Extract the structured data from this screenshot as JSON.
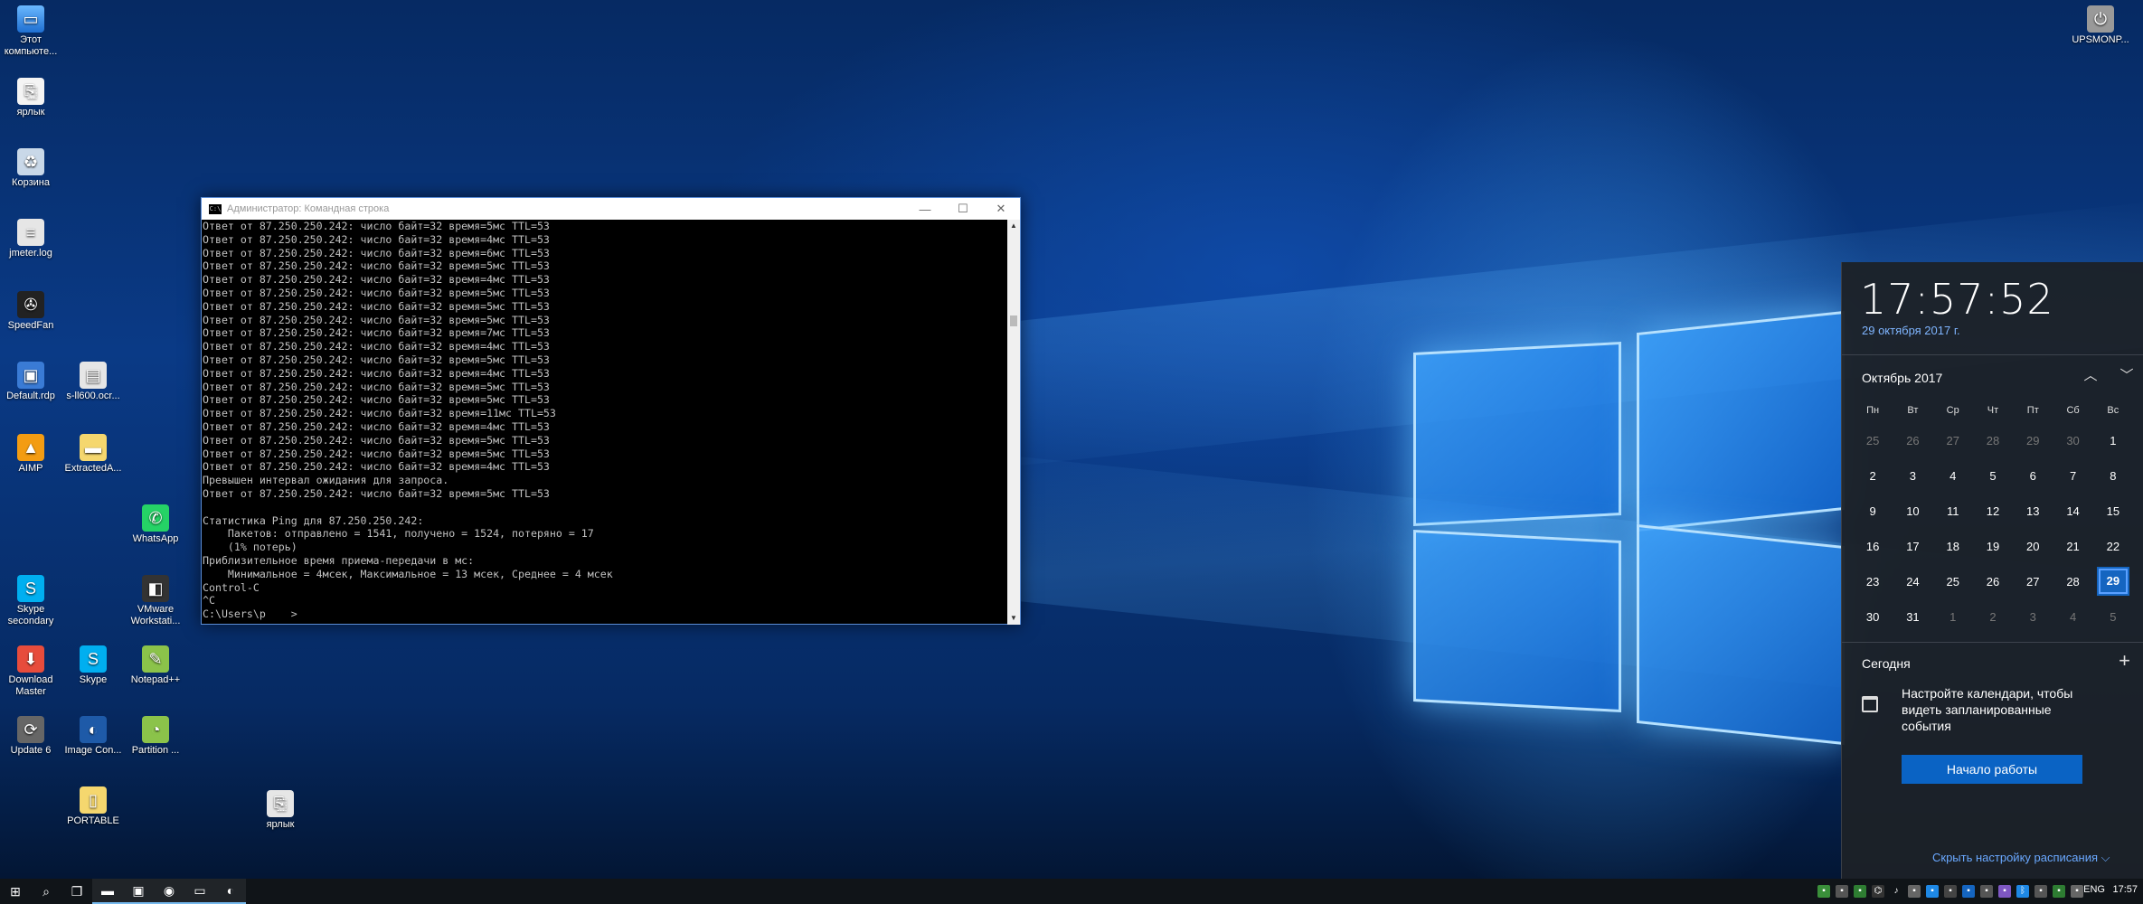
{
  "desktop_icons": [
    {
      "label": "Этот компьюте...",
      "icon": "this-pc-icon"
    },
    {
      "label": "ярлык",
      "icon": "shortcut-file-icon"
    },
    {
      "label": "Корзина",
      "icon": "recycle-bin-icon"
    },
    {
      "label": "jmeter.log",
      "icon": "log-file-icon"
    },
    {
      "label": "SpeedFan",
      "icon": "speedfan-icon"
    },
    {
      "label": "Default.rdp",
      "icon": "rdp-icon"
    },
    {
      "label": "s-ll600.ocr...",
      "icon": "document-icon"
    },
    {
      "label": "AIMP",
      "icon": "aimp-icon"
    },
    {
      "label": "ExtractedA...",
      "icon": "folder-icon"
    },
    {
      "label": "WhatsApp",
      "icon": "whatsapp-icon"
    },
    {
      "label": "Skype secondary",
      "icon": "skype-icon"
    },
    {
      "label": "VMware Workstati...",
      "icon": "vmware-icon"
    },
    {
      "label": "Download Master",
      "icon": "download-master-icon"
    },
    {
      "label": "Skype",
      "icon": "skype-icon"
    },
    {
      "label": "Notepad++",
      "icon": "notepadpp-icon"
    },
    {
      "label": "Update 6",
      "icon": "update-icon"
    },
    {
      "label": "Image Con...",
      "icon": "image-converter-icon"
    },
    {
      "label": "Partition ...",
      "icon": "partition-tool-icon"
    },
    {
      "label": "PORTABLE",
      "icon": "portable-icon"
    },
    {
      "label": "ярлык",
      "icon": "shortcut-icon"
    },
    {
      "label": "UPSMONP...",
      "icon": "ups-monitor-icon"
    }
  ],
  "cmd": {
    "title": "Администратор: Командная строка",
    "lines": [
      "Ответ от 87.250.250.242: число байт=32 время=5мс TTL=53",
      "Ответ от 87.250.250.242: число байт=32 время=4мс TTL=53",
      "Ответ от 87.250.250.242: число байт=32 время=6мс TTL=53",
      "Ответ от 87.250.250.242: число байт=32 время=5мс TTL=53",
      "Ответ от 87.250.250.242: число байт=32 время=4мс TTL=53",
      "Ответ от 87.250.250.242: число байт=32 время=5мс TTL=53",
      "Ответ от 87.250.250.242: число байт=32 время=5мс TTL=53",
      "Ответ от 87.250.250.242: число байт=32 время=5мс TTL=53",
      "Ответ от 87.250.250.242: число байт=32 время=7мс TTL=53",
      "Ответ от 87.250.250.242: число байт=32 время=4мс TTL=53",
      "Ответ от 87.250.250.242: число байт=32 время=5мс TTL=53",
      "Ответ от 87.250.250.242: число байт=32 время=4мс TTL=53",
      "Ответ от 87.250.250.242: число байт=32 время=5мс TTL=53",
      "Ответ от 87.250.250.242: число байт=32 время=5мс TTL=53",
      "Ответ от 87.250.250.242: число байт=32 время=11мс TTL=53",
      "Ответ от 87.250.250.242: число байт=32 время=4мс TTL=53",
      "Ответ от 87.250.250.242: число байт=32 время=5мс TTL=53",
      "Ответ от 87.250.250.242: число байт=32 время=5мс TTL=53",
      "Ответ от 87.250.250.242: число байт=32 время=4мс TTL=53",
      "Превышен интервал ожидания для запроса.",
      "Ответ от 87.250.250.242: число байт=32 время=5мс TTL=53",
      "",
      "Статистика Ping для 87.250.250.242:",
      "    Пакетов: отправлено = 1541, получено = 1524, потеряно = 17",
      "    (1% потерь)",
      "Приблизительное время приема-передачи в мс:",
      "    Минимальное = 4мсек, Максимальное = 13 мсек, Среднее = 4 мсек",
      "Control-C",
      "^C",
      "C:\\Users\\p    >"
    ]
  },
  "calendar": {
    "time": "17:57:52",
    "date": "29 октября 2017 г.",
    "month": "Октябрь 2017",
    "weekdays": [
      "Пн",
      "Вт",
      "Ср",
      "Чт",
      "Пт",
      "Сб",
      "Вс"
    ],
    "days": [
      {
        "d": "25",
        "dim": true
      },
      {
        "d": "26",
        "dim": true
      },
      {
        "d": "27",
        "dim": true
      },
      {
        "d": "28",
        "dim": true
      },
      {
        "d": "29",
        "dim": true
      },
      {
        "d": "30",
        "dim": true
      },
      {
        "d": "1"
      },
      {
        "d": "2"
      },
      {
        "d": "3"
      },
      {
        "d": "4"
      },
      {
        "d": "5"
      },
      {
        "d": "6"
      },
      {
        "d": "7"
      },
      {
        "d": "8"
      },
      {
        "d": "9"
      },
      {
        "d": "10"
      },
      {
        "d": "11"
      },
      {
        "d": "12"
      },
      {
        "d": "13"
      },
      {
        "d": "14"
      },
      {
        "d": "15"
      },
      {
        "d": "16"
      },
      {
        "d": "17"
      },
      {
        "d": "18"
      },
      {
        "d": "19"
      },
      {
        "d": "20"
      },
      {
        "d": "21"
      },
      {
        "d": "22"
      },
      {
        "d": "23"
      },
      {
        "d": "24"
      },
      {
        "d": "25"
      },
      {
        "d": "26"
      },
      {
        "d": "27"
      },
      {
        "d": "28"
      },
      {
        "d": "29",
        "today": true
      },
      {
        "d": "30"
      },
      {
        "d": "31"
      },
      {
        "d": "1",
        "dim": true
      },
      {
        "d": "2",
        "dim": true
      },
      {
        "d": "3",
        "dim": true
      },
      {
        "d": "4",
        "dim": true
      },
      {
        "d": "5",
        "dim": true
      }
    ],
    "today_heading": "Сегодня",
    "setup_text": "Настройте календари, чтобы видеть запланированные события",
    "start_button": "Начало работы",
    "hide_link": "Скрыть настройку расписания"
  },
  "taskbar": {
    "items": [
      "start-icon",
      "search-icon",
      "task-view-icon",
      "file-explorer-icon",
      "app-icon",
      "chrome-icon",
      "cmd-icon",
      "viewer-icon"
    ],
    "language": "ENG",
    "clock": "17:57"
  },
  "colors": {
    "accent": "#1565c0",
    "link": "#6aa8ff",
    "console_text": "#c0c0c0"
  }
}
